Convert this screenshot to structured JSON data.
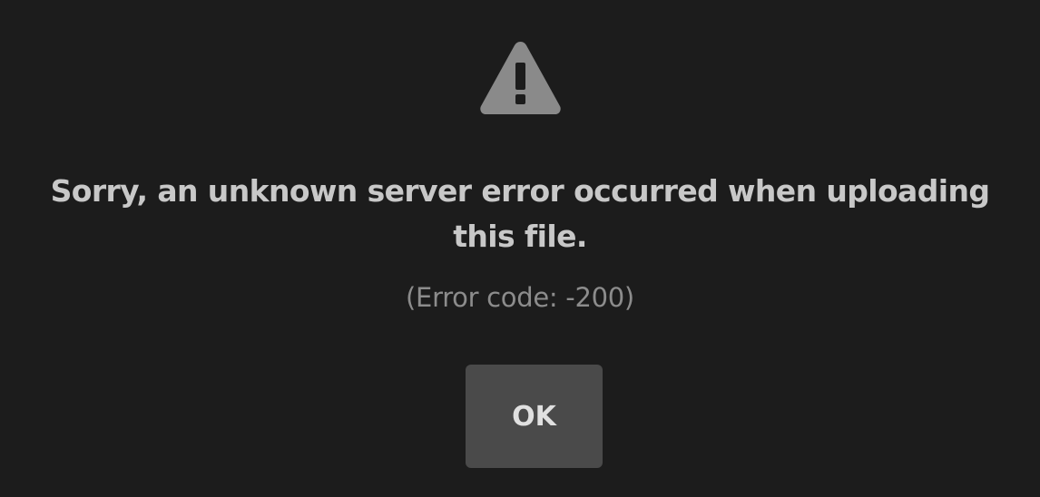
{
  "dialog": {
    "icon": "warning-triangle-icon",
    "message": "Sorry, an unknown server error occurred when uploading this file.",
    "error_code": "(Error code: -200)",
    "ok_label": "OK"
  },
  "colors": {
    "background": "#1c1c1c",
    "icon": "#8a8a8a",
    "message_text": "#c8c8c8",
    "error_code_text": "#8c8c8c",
    "button_bg": "#4a4a4a",
    "button_text": "#e0e0e0"
  }
}
